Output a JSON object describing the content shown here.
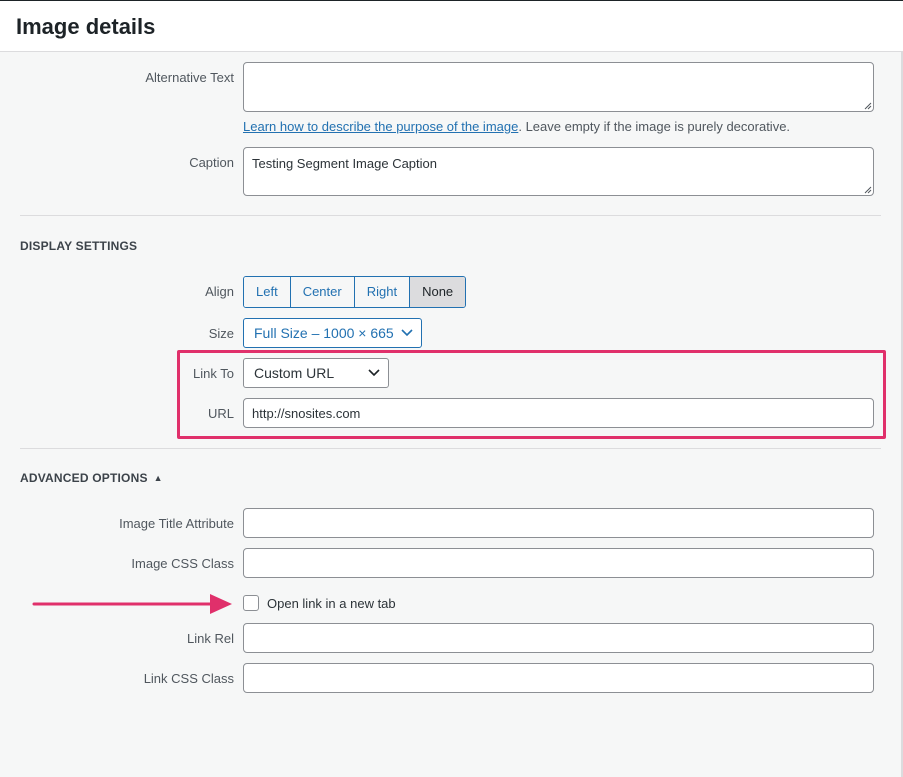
{
  "dialog": {
    "title": "Image details"
  },
  "alt_text": {
    "label": "Alternative Text",
    "value": "",
    "hint_link": "Learn how to describe the purpose of the image",
    "hint_text": ". Leave empty if the image is purely decorative."
  },
  "caption": {
    "label": "Caption",
    "value": "Testing Segment Image Caption"
  },
  "display_settings": {
    "heading": "DISPLAY SETTINGS",
    "align": {
      "label": "Align",
      "options": [
        "Left",
        "Center",
        "Right",
        "None"
      ],
      "selected": "None"
    },
    "size": {
      "label": "Size",
      "value": "Full Size – 1000 × 665"
    },
    "link_to": {
      "label": "Link To",
      "value": "Custom URL"
    },
    "url": {
      "label": "URL",
      "value": "http://snosites.com"
    }
  },
  "advanced_options": {
    "heading": "ADVANCED OPTIONS",
    "toggle_glyph": "▲",
    "image_title_attribute": {
      "label": "Image Title Attribute",
      "value": ""
    },
    "image_css_class": {
      "label": "Image CSS Class",
      "value": ""
    },
    "open_new_tab": {
      "label": "Open link in a new tab",
      "checked": false
    },
    "link_rel": {
      "label": "Link Rel",
      "value": ""
    },
    "link_css_class": {
      "label": "Link CSS Class",
      "value": ""
    }
  },
  "colors": {
    "accent": "#2271b1",
    "highlight": "#e0306b",
    "background": "#f6f7f7"
  }
}
